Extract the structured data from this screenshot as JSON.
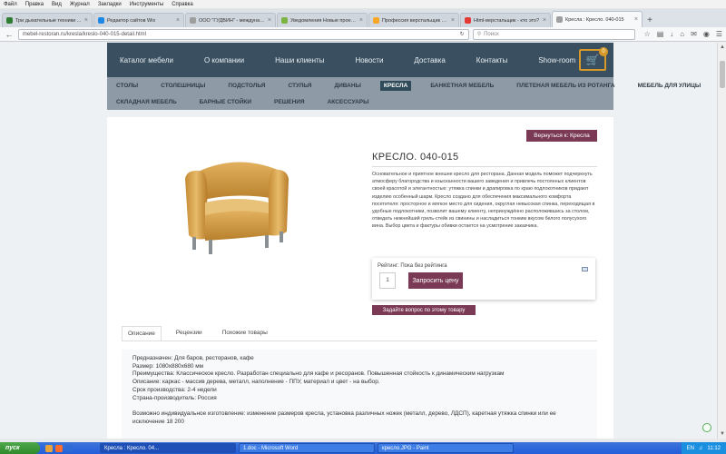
{
  "browser": {
    "menu": [
      "Файл",
      "Правка",
      "Вид",
      "Журнал",
      "Закладки",
      "Инструменты",
      "Справка"
    ],
    "tabs": [
      {
        "title": "Три дыхательные техники ...",
        "color": "#2e7d32",
        "active": false
      },
      {
        "title": "Редактор сайтов Wix",
        "color": "#1e88e5",
        "active": false
      },
      {
        "title": "ООО \"ГУДВИН\" - междунаро...",
        "color": "#9e9e9e",
        "active": false
      },
      {
        "title": "Уведомления Новые проект...",
        "color": "#7cb342",
        "active": false
      },
      {
        "title": "Профессия верстальщик - д...",
        "color": "#f9a825",
        "active": false
      },
      {
        "title": "Html-верстальщик - кто это?",
        "color": "#e53935",
        "active": false
      },
      {
        "title": "Кресла : Кресло. 040-015",
        "color": "#9e9e9e",
        "active": true
      }
    ],
    "url": "mebel-restoran.ru/kresla/kreslo-040-015-detail.html",
    "search_placeholder": "Поиск"
  },
  "site": {
    "topnav": [
      "Каталог мебели",
      "О компании",
      "Наши клиенты",
      "Новости",
      "Доставка",
      "Контакты",
      "Show-room"
    ],
    "cart_count": "0",
    "categories_row1": [
      "Столы",
      "Столешницы",
      "Подстолья",
      "Стулья",
      "Диваны",
      "Кресла",
      "Банкетная мебель",
      "Плетеная мебель из ротанга",
      "Мебель для улицы"
    ],
    "categories_row2": [
      "Складная мебель",
      "Барные стойки",
      "Решения",
      "Аксессуары"
    ],
    "active_category": "Кресла"
  },
  "product": {
    "back_label": "Вернуться к: Кресла",
    "title": "КРЕСЛО. 040-015",
    "description": "Основательное и приятное внешне кресло для ресторана. Данная модель поможет подчеркнуть атмосферу благородства и изысканности вашего заведения и привлечь постоянных клиентов своей красотой и элегантностью: утяжка спинки и драпировка по краю подлокотников придают изделию особенный шарм. Кресло создано для обеспечения максимального комфорта посетителя: просторное и мягкое место для сидения, округлая невысокая спинка, переходящая в удобные подлокотники, позволит вашему клиенту, непринуждённо расположившись за столом, отведать нежнейший гриль-стейк из свинины и насладиться тонким вкусом белого полусухого вина. Выбор цвета и фактуры обивки остается на усмотрение заказчика.",
    "rating_label": "Рейтинг: Пока без рейтинга",
    "quantity": "1",
    "request_price_label": "Запросить цену",
    "ask_label": "Задайте вопрос по этому товару",
    "tabs": [
      "Описание",
      "Рецензии",
      "Похожие товары"
    ],
    "specs": [
      "Предназначен: Для баров, ресторанов, кафе",
      "Размер: 1080х880х680 мм",
      "Преимущества: Классическое кресло. Разработан специально для кафе и ресоранов. Повышенная стойкость к динамическим нагрузкам",
      "Описание: каркас - массив дерева, металл, наполнение - ППУ, материал и цвет - на выбор.",
      "Срок производства: 2-4 недели",
      "Страна-производитель: Россия"
    ],
    "extra_1": "Возможно индивидуальное изготовление: изменение размеров кресла, установка различных ножек (металл, дерево, ЛДСП), каретная утяжка спинки или ее",
    "extra_2": "исключение 18 200"
  },
  "taskbar": {
    "start": "пуск",
    "tasks": [
      "Кресла : Кресло. 04...",
      "1.doc - Microsoft Word",
      "кресло.JPG - Paint"
    ],
    "lang": "EN",
    "time": "11:12"
  }
}
